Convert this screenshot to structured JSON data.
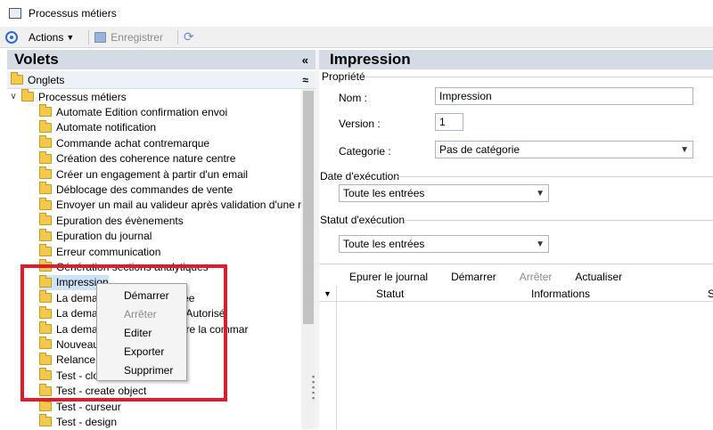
{
  "window": {
    "title": "Processus métiers"
  },
  "toolbar": {
    "actions_label": "Actions",
    "save_label": "Enregistrer"
  },
  "left": {
    "header": "Volets",
    "collapse_glyph": "«",
    "onglets_label": "Onglets",
    "onglets_glyph": "≈",
    "root_label": "Processus métiers",
    "items": [
      "Automate Edition confirmation envoi",
      "Automate notification",
      "Commande achat contremarque",
      "Création des coherence nature centre",
      "Créer un engagement à partir d'un email",
      "Déblocage des commandes de vente",
      "Envoyer un mail au valideur après validation d'une rer",
      "Epuration des évènements",
      "Epuration du journal",
      "Erreur communication",
      "Génération sections analytiques",
      "Impression",
      "La demande ... est confirmée",
      "La demande ... st en Achat Autorisé",
      "La demande ... alidée génère la commar",
      "Nouveau",
      "Relance c",
      "Test - clo",
      "Test - create object",
      "Test - curseur",
      "Test - design"
    ]
  },
  "right": {
    "header": "Impression",
    "propriete_label": "Propriété",
    "nom_label": "Nom :",
    "nom_value": "Impression",
    "version_label": "Version :",
    "version_value": "1",
    "categorie_label": "Categorie :",
    "categorie_value": "Pas de catégorie",
    "date_label": "Date d'exécution",
    "date_value": "Toute les entrées",
    "statut_label": "Statut d'exécution",
    "statut_value": "Toute les entrées",
    "grid_toolbar": [
      "Epurer le journal",
      "Démarrer",
      "Arrêter",
      "Actualiser"
    ],
    "grid_columns": [
      "Statut",
      "Informations",
      "S"
    ]
  },
  "context_menu": [
    "Démarrer",
    "Arrêter",
    "Editer",
    "Exporter",
    "Supprimer"
  ],
  "colors": {
    "annotation": "#e01c2a",
    "header_bg": "#d4dbe4",
    "folder": "#f2c94c"
  }
}
